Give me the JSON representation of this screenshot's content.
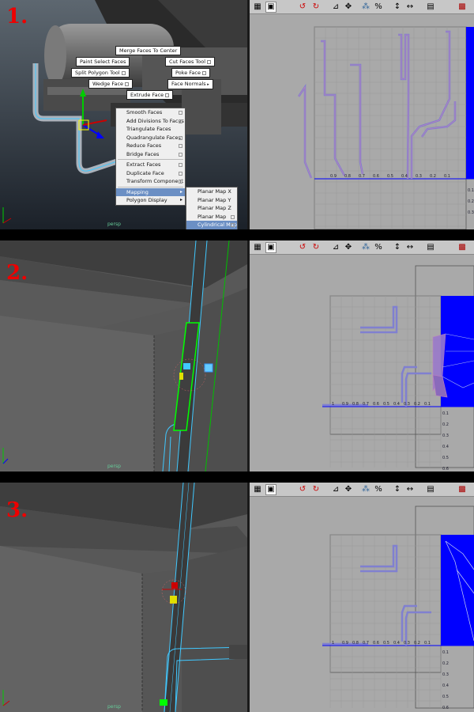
{
  "steps": [
    {
      "number": "1.",
      "camera": "persp"
    },
    {
      "number": "2.",
      "camera": "persp"
    },
    {
      "number": "3.",
      "camera": "persp"
    }
  ],
  "marking_menu": {
    "merge_faces_to_center": "Merge Faces To Center",
    "paint_select_faces": "Paint Select Faces",
    "cut_faces_tool": "Cut Faces Tool",
    "split_polygon_tool": "Split Polygon Tool",
    "poke_face": "Poke Face",
    "wedge_face": "Wedge Face",
    "face_normals": "Face Normals",
    "extrude_face": "Extrude Face"
  },
  "context_menu": {
    "items": [
      {
        "label": "Smooth Faces",
        "option_box": true
      },
      {
        "label": "Add Divisions To Faces",
        "option_box": true
      },
      {
        "label": "Triangulate Faces",
        "option_box": false
      },
      {
        "label": "Quadrangulate Faces",
        "option_box": true
      },
      {
        "label": "Reduce Faces",
        "option_box": true
      },
      {
        "label": "Bridge Faces",
        "option_box": true
      },
      {
        "label": "Extract Faces",
        "option_box": true
      },
      {
        "label": "Duplicate Face",
        "option_box": true
      },
      {
        "label": "Transform Component",
        "option_box": true
      },
      {
        "label": "Mapping",
        "submenu": true,
        "highlighted": true
      },
      {
        "label": "Polygon Display",
        "submenu": true
      }
    ],
    "submenu": [
      {
        "label": "Planar Map X"
      },
      {
        "label": "Planar Map Y"
      },
      {
        "label": "Planar Map Z"
      },
      {
        "label": "Planar Map",
        "option_box": true
      },
      {
        "label": "Cylindrical Map",
        "option_box": true,
        "highlighted": true
      }
    ]
  },
  "uv_editor": {
    "axis_labels_p1": [
      "0.9",
      "0.8",
      "0.7",
      "0.6",
      "0.5",
      "0.4",
      "0.3",
      "0.2",
      "0.1"
    ],
    "axis_labels_p2_x": [
      "1",
      "0.9",
      "0.8",
      "0.7",
      "0.6",
      "0.5",
      "0.4",
      "0.3",
      "0.2",
      "0.1"
    ],
    "axis_labels_p2_y": [
      "0.1",
      "0.2",
      "0.3",
      "0.4",
      "0.5",
      "0.6",
      "0.7"
    ],
    "axis_labels_p3_x": [
      "1",
      "0.9",
      "0.8",
      "0.7",
      "0.6",
      "0.5",
      "0.4",
      "0.3",
      "0.2",
      "0.1"
    ],
    "axis_labels_p3_y": [
      "0.1",
      "0.2",
      "0.3",
      "0.4",
      "0.5",
      "0.6",
      "0.7"
    ],
    "axis_labels_p1_y": [
      "0.1",
      "0.2",
      "0.3"
    ],
    "uv_color": "#0000ff",
    "shell_color": "#8080d0"
  },
  "colors": {
    "step_number": "#ee0000",
    "menu_highlight": "#6b8fc4",
    "selection_green": "#00ff00",
    "wire_cyan": "#40c8ff"
  }
}
